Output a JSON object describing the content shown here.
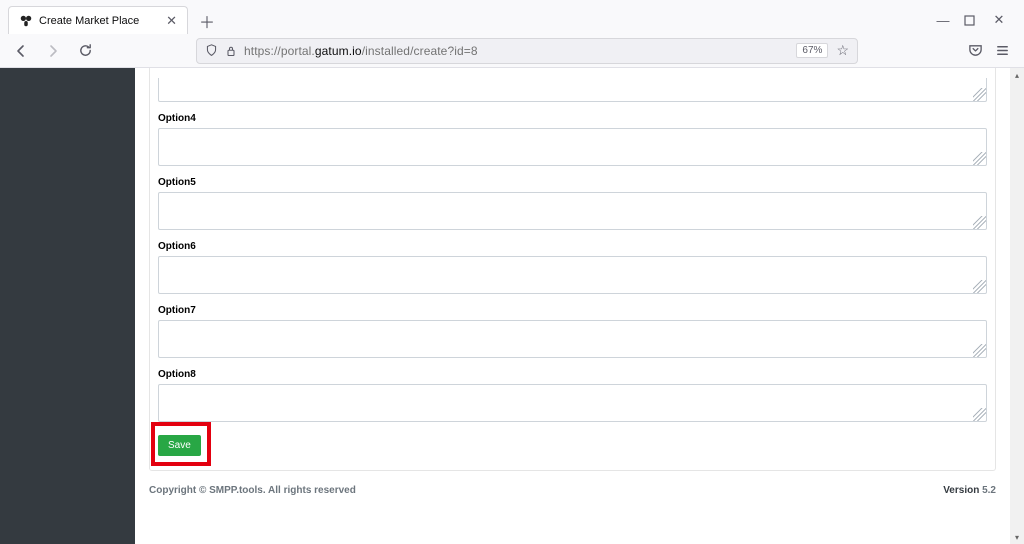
{
  "browser": {
    "tab_title": "Create Market Place",
    "url_prefix": "https://portal.",
    "url_host": "gatum.io",
    "url_path": "/installed/create?id=8",
    "zoom": "67%"
  },
  "form": {
    "partial_top_value": "",
    "groups": [
      {
        "label": "Option4",
        "value": ""
      },
      {
        "label": "Option5",
        "value": ""
      },
      {
        "label": "Option6",
        "value": ""
      },
      {
        "label": "Option7",
        "value": ""
      },
      {
        "label": "Option8",
        "value": ""
      }
    ],
    "save_label": "Save"
  },
  "footer": {
    "copyright": "Copyright © SMPP.tools. All rights reserved",
    "version_label": "Version ",
    "version_value": "5.2"
  }
}
